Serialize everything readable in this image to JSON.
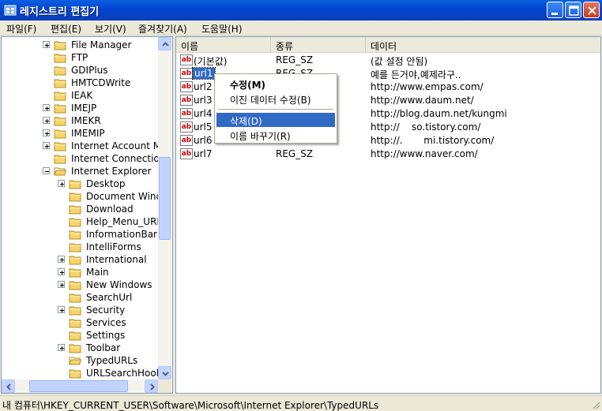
{
  "window": {
    "title": "레지스트리 편집기"
  },
  "menu": [
    "파일(F)",
    "편집(E)",
    "보기(V)",
    "즐겨찾기(A)",
    "도움말(H)"
  ],
  "tree": [
    {
      "label": "File Manager",
      "expander": "plus",
      "depth": 0
    },
    {
      "label": "FTP",
      "expander": "none",
      "depth": 0
    },
    {
      "label": "GDIPlus",
      "expander": "none",
      "depth": 0
    },
    {
      "label": "HMTCDWrite",
      "expander": "none",
      "depth": 0
    },
    {
      "label": "IEAK",
      "expander": "none",
      "depth": 0
    },
    {
      "label": "IMEJP",
      "expander": "plus",
      "depth": 0
    },
    {
      "label": "IMEKR",
      "expander": "plus",
      "depth": 0
    },
    {
      "label": "IMEMIP",
      "expander": "plus",
      "depth": 0
    },
    {
      "label": "Internet Account Ma",
      "expander": "plus",
      "depth": 0
    },
    {
      "label": "Internet Connection",
      "expander": "none",
      "depth": 0
    },
    {
      "label": "Internet Explorer",
      "expander": "minus",
      "depth": 0,
      "open": true
    },
    {
      "label": "Desktop",
      "expander": "plus",
      "depth": 1
    },
    {
      "label": "Document Windo",
      "expander": "none",
      "depth": 1
    },
    {
      "label": "Download",
      "expander": "none",
      "depth": 1
    },
    {
      "label": "Help_Menu_URL",
      "expander": "none",
      "depth": 1
    },
    {
      "label": "InformationBar",
      "expander": "none",
      "depth": 1
    },
    {
      "label": "IntelliForms",
      "expander": "none",
      "depth": 1
    },
    {
      "label": "International",
      "expander": "plus",
      "depth": 1
    },
    {
      "label": "Main",
      "expander": "plus",
      "depth": 1
    },
    {
      "label": "New Windows",
      "expander": "plus",
      "depth": 1
    },
    {
      "label": "SearchUrl",
      "expander": "none",
      "depth": 1
    },
    {
      "label": "Security",
      "expander": "plus",
      "depth": 1
    },
    {
      "label": "Services",
      "expander": "none",
      "depth": 1
    },
    {
      "label": "Settings",
      "expander": "none",
      "depth": 1
    },
    {
      "label": "Toolbar",
      "expander": "plus",
      "depth": 1
    },
    {
      "label": "TypedURLs",
      "expander": "none",
      "depth": 1,
      "open": true
    },
    {
      "label": "URLSearchHook",
      "expander": "none",
      "depth": 1
    }
  ],
  "list": {
    "columns": [
      "이름",
      "종류",
      "데이터"
    ],
    "rows": [
      {
        "name": "(기본값)",
        "type": "REG_SZ",
        "data": "(값 설정 안됨)"
      },
      {
        "name": "url1",
        "type": "REG_SZ",
        "data": "예를 든거야,예제라구..",
        "selected": true
      },
      {
        "name": "url2",
        "type": "",
        "data": "http://www.empas.com/"
      },
      {
        "name": "url3",
        "type": "",
        "data": "http://www.daum.net/"
      },
      {
        "name": "url4",
        "type": "",
        "data": "http://blog.daum.net/kungmi"
      },
      {
        "name": "url5",
        "type": "",
        "data": "http://    so.tistory.com/"
      },
      {
        "name": "url6",
        "type": "",
        "data": "http://.       mi.tistory.com/"
      },
      {
        "name": "url7",
        "type": "REG_SZ",
        "data": "http://www.naver.com/"
      }
    ],
    "icon_text": "ab"
  },
  "context_menu": {
    "items": [
      {
        "label": "수정(M)",
        "bold": true
      },
      {
        "label": "이진 데이터 수정(B)"
      },
      {
        "separator": true
      },
      {
        "label": "삭제(D)",
        "highlighted": true
      },
      {
        "label": "이름 바꾸기(R)"
      }
    ]
  },
  "status": {
    "path": "내 컴퓨터\\HKEY_CURRENT_USER\\Software\\Microsoft\\Internet Explorer\\TypedURLs"
  },
  "colors": {
    "titlebar": "#0344d0",
    "selection": "#316ac5",
    "folder": "#f5d56b"
  }
}
